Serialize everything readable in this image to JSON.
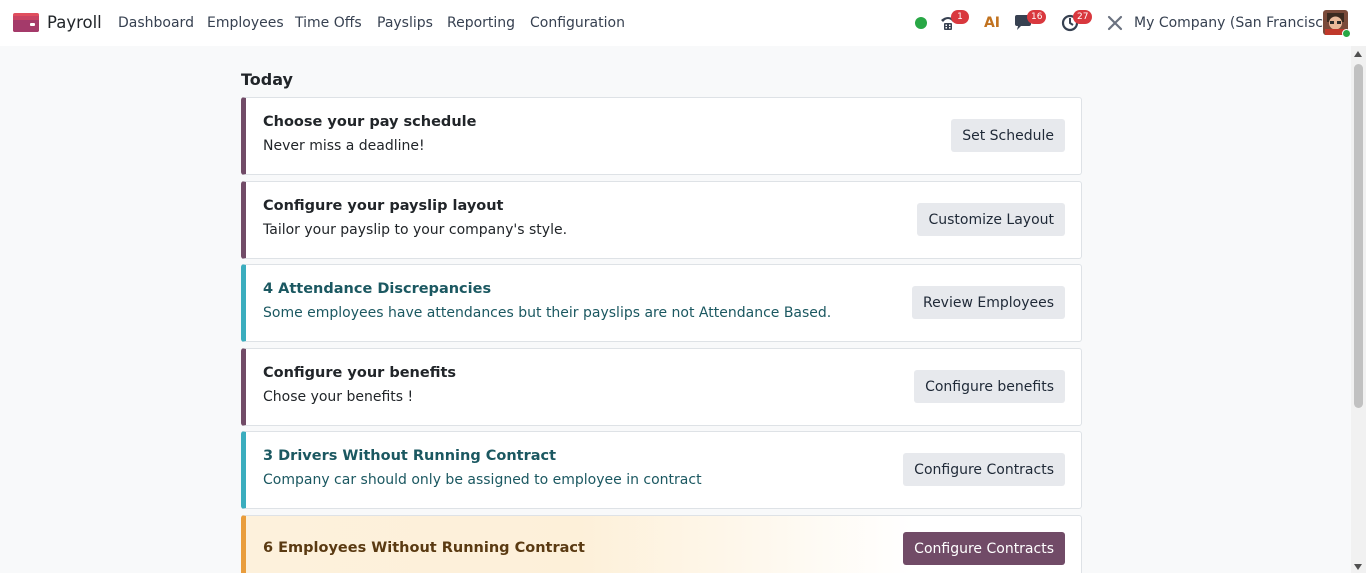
{
  "app": {
    "name": "Payroll",
    "brand_color": "#714b67"
  },
  "menu": [
    {
      "label": "Dashboard"
    },
    {
      "label": "Employees"
    },
    {
      "label": "Time Offs"
    },
    {
      "label": "Payslips"
    },
    {
      "label": "Reporting"
    },
    {
      "label": "Configuration"
    }
  ],
  "systray": {
    "status_color": "#28a745",
    "phone_badge": "1",
    "messages_badge": "16",
    "activities_badge": "27",
    "ai_label": "AI",
    "company": "My Company (San Francisco)"
  },
  "main": {
    "section_title": "Today",
    "cards": [
      {
        "title": "Choose your pay schedule",
        "description": "Never miss a deadline!",
        "button": "Set Schedule",
        "style": "default"
      },
      {
        "title": "Configure your payslip layout",
        "description": "Tailor your payslip to your company's style.",
        "button": "Customize Layout",
        "style": "default"
      },
      {
        "title": "4 Attendance Discrepancies",
        "description": "Some employees have attendances but their payslips are not Attendance Based.",
        "button": "Review Employees",
        "style": "info"
      },
      {
        "title": "Configure your benefits",
        "description": "Chose your benefits !",
        "button": "Configure benefits",
        "style": "default"
      },
      {
        "title": "3 Drivers Without Running Contract",
        "description": "Company car should only be assigned to employee in contract",
        "button": "Configure Contracts",
        "style": "info"
      },
      {
        "title": "6 Employees Without Running Contract",
        "description": "",
        "button": "Configure Contracts",
        "style": "warning"
      }
    ]
  }
}
